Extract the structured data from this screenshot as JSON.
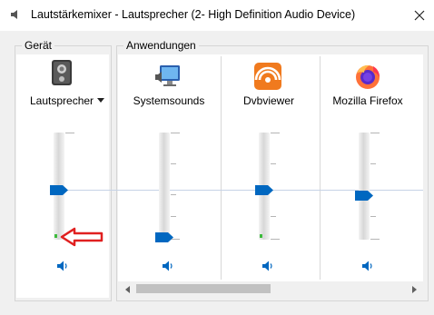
{
  "window": {
    "title": "Lautstärkemixer - Lautsprecher (2- High Definition Audio Device)",
    "close_icon": "close-icon"
  },
  "device": {
    "group_label": "Gerät",
    "name": "Lautsprecher",
    "dropdown_icon": "caret-down-icon",
    "icon": "speaker-device-icon",
    "volume_level": 0.55,
    "peak_level": 0.0,
    "mute_icon": "speaker-icon"
  },
  "applications": {
    "group_label": "Anwendungen",
    "channels": [
      {
        "name": "Systemsounds",
        "icon": "system-sounds-icon",
        "volume_level": 0.0,
        "mute_icon": "speaker-icon"
      },
      {
        "name": "Dvbviewer",
        "icon": "dvbviewer-icon",
        "volume_level": 0.55,
        "mute_icon": "speaker-icon"
      },
      {
        "name": "Mozilla Firefox",
        "icon": "firefox-icon",
        "volume_level": 0.45,
        "mute_icon": "speaker-icon"
      }
    ]
  },
  "scrollbar": {
    "left_icon": "scroll-left-icon",
    "right_icon": "scroll-right-icon"
  },
  "annotation": {
    "icon": "red-arrow-icon",
    "color": "#e02020"
  },
  "colors": {
    "accent": "#0067c0",
    "meter": "#3dbb3d"
  }
}
